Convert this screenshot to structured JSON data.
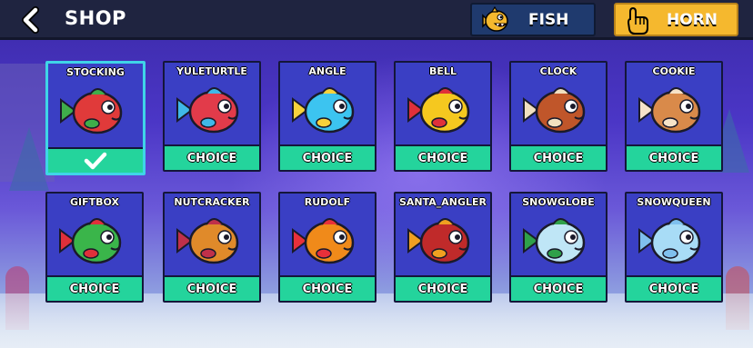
{
  "header": {
    "title": "SHOP",
    "tabs": [
      {
        "label": "FISH",
        "icon": "fish-icon",
        "active": false
      },
      {
        "label": "HORN",
        "icon": "pointing-hand-icon",
        "active": true
      }
    ]
  },
  "items": [
    {
      "name": "STOCKING",
      "state": "equipped",
      "button": "",
      "body": "#e03a3a",
      "accent": "#3fae4a"
    },
    {
      "name": "YULETURTLE",
      "state": "choice",
      "button": "CHOICE",
      "body": "#e23b4a",
      "accent": "#3fb8e8"
    },
    {
      "name": "ANGLE",
      "state": "choice",
      "button": "CHOICE",
      "body": "#3cc4f0",
      "accent": "#f7d23c"
    },
    {
      "name": "BELL",
      "state": "choice",
      "button": "CHOICE",
      "body": "#f5c81f",
      "accent": "#e0303a"
    },
    {
      "name": "CLOCK",
      "state": "choice",
      "button": "CHOICE",
      "body": "#c0562a",
      "accent": "#f1e0c0"
    },
    {
      "name": "COOKIE",
      "state": "choice",
      "button": "CHOICE",
      "body": "#d98a4a",
      "accent": "#f6e3c9"
    },
    {
      "name": "GIFTBOX",
      "state": "choice",
      "button": "CHOICE",
      "body": "#3ab54a",
      "accent": "#e0303a"
    },
    {
      "name": "NUTCRACKER",
      "state": "choice",
      "button": "CHOICE",
      "body": "#e08a2a",
      "accent": "#c0304a"
    },
    {
      "name": "RUDOLF",
      "state": "choice",
      "button": "CHOICE",
      "body": "#f08a1a",
      "accent": "#e8303a"
    },
    {
      "name": "SANTA_ANGLER",
      "state": "choice",
      "button": "CHOICE",
      "body": "#c02a2a",
      "accent": "#f0a020"
    },
    {
      "name": "SNOWGLOBE",
      "state": "choice",
      "button": "CHOICE",
      "body": "#bfe6f6",
      "accent": "#2fa04a"
    },
    {
      "name": "SNOWQUEEN",
      "state": "choice",
      "button": "CHOICE",
      "body": "#a8dcf6",
      "accent": "#7fc0ee"
    }
  ],
  "colors": {
    "topbar": "#1f2440",
    "card": "#3a3fc4",
    "choice_button": "#24d49c",
    "selected_border": "#3fd4e8",
    "horn_tab": "#f5b82e",
    "fish_tab": "#1f3a6e"
  }
}
